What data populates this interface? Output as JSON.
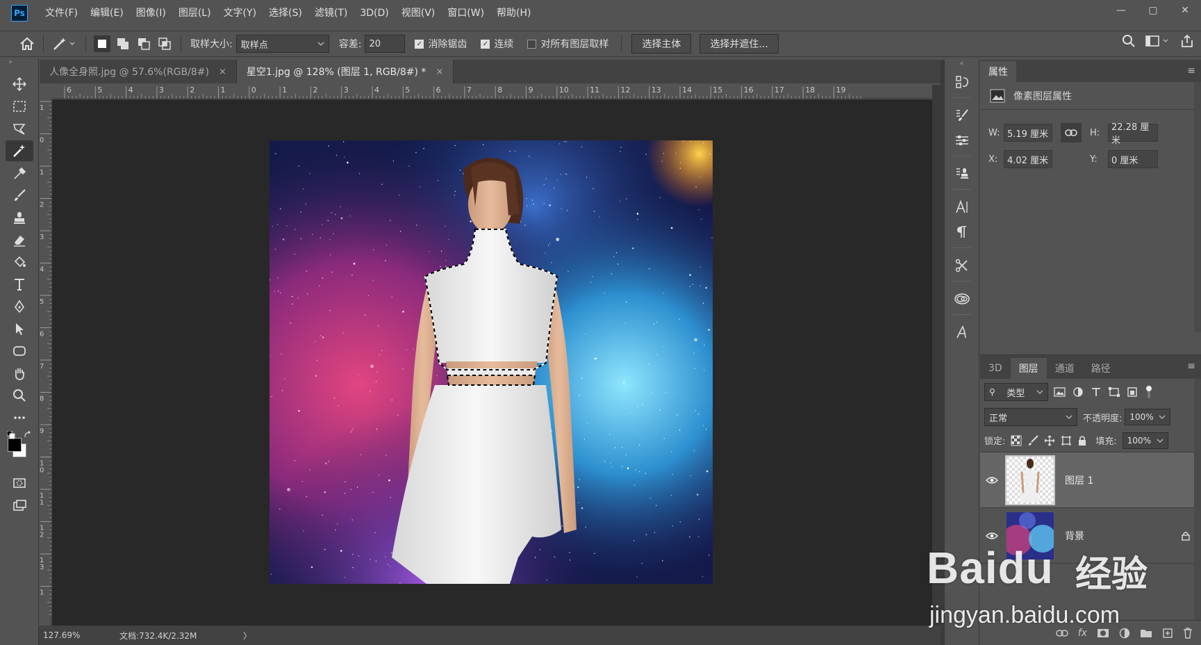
{
  "app": {
    "logo": "Ps",
    "menu": [
      "文件(F)",
      "编辑(E)",
      "图像(I)",
      "图层(L)",
      "文字(Y)",
      "选择(S)",
      "滤镜(T)",
      "3D(D)",
      "视图(V)",
      "窗口(W)",
      "帮助(H)"
    ],
    "window_controls": [
      "—",
      "▢",
      "✕"
    ]
  },
  "options": {
    "sample_size_label": "取样大小:",
    "sample_size_value": "取样点",
    "tolerance_label": "容差:",
    "tolerance_value": "20",
    "anti_alias_label": "消除锯齿",
    "contiguous_label": "连续",
    "sample_all_label": "对所有图层取样",
    "select_subject_label": "选择主体",
    "select_mask_label": "选择并遮住..."
  },
  "tabs": [
    {
      "label": "人像全身照.jpg @ 57.6%(RGB/8#)",
      "close": "×",
      "active": false
    },
    {
      "label": "星空1.jpg @ 128% (图层 1, RGB/8#) *",
      "close": "×",
      "active": true
    }
  ],
  "ruler": {
    "h_ticks": [
      "6",
      "5",
      "4",
      "3",
      "2",
      "1",
      "0",
      "1",
      "2",
      "3",
      "4",
      "5",
      "6",
      "7",
      "8",
      "9",
      "10",
      "11",
      "12",
      "13",
      "14",
      "15",
      "16",
      "17",
      "18",
      "19"
    ],
    "v_ticks": [
      "1",
      "0",
      "1",
      "2",
      "3",
      "4",
      "5",
      "6",
      "7",
      "8",
      "9",
      "1\n0",
      "1\n1",
      "1\n2",
      "1\n3",
      "1"
    ]
  },
  "status": {
    "zoom": "127.69%",
    "doc": "文档:732.4K/2.32M",
    "arrow": "〉"
  },
  "properties": {
    "tab": "属性",
    "subtitle": "像素图层属性",
    "w_label": "W:",
    "w_value": "5.19 厘米",
    "h_label": "H:",
    "h_value": "22.28 厘米",
    "x_label": "X:",
    "x_value": "4.02 厘米",
    "y_label": "Y:",
    "y_value": "0 厘米"
  },
  "layers_panel": {
    "tabs": [
      "3D",
      "图层",
      "通道",
      "路径"
    ],
    "active_tab": "图层",
    "filter_value": "类型",
    "blend_mode": "正常",
    "opacity_label": "不透明度:",
    "opacity_value": "100%",
    "lock_label": "锁定:",
    "fill_label": "填充:",
    "fill_value": "100%",
    "layers": [
      {
        "name": "图层 1",
        "selected": true
      },
      {
        "name": "背景",
        "selected": false
      }
    ],
    "footer_fx": "fx"
  },
  "watermark": {
    "brand": "Baidu",
    "brand_cn": "经验",
    "url": "jingyan.baidu.com"
  },
  "colors": {
    "bg": "#535353",
    "canvas_bg": "#282828",
    "accent": "#31a8ff"
  }
}
